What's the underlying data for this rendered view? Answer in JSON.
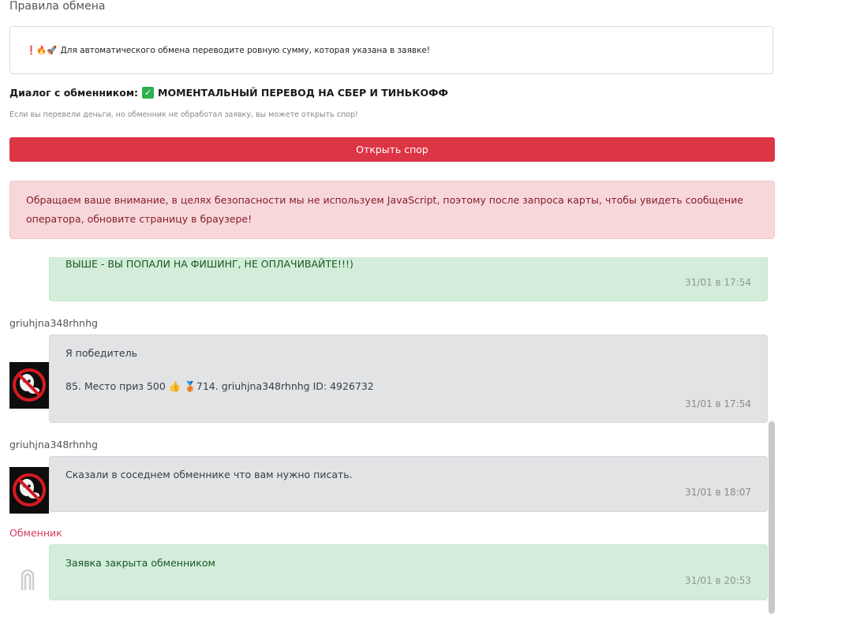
{
  "rules": {
    "title": "Правила обмена",
    "emojis": "❗🔥🚀",
    "text": "Для автоматического обмена переводите ровную сумму, которая указана в заявке!"
  },
  "dialog": {
    "label": "Диалог с обменником:",
    "exchanger_name": "МОМЕНТАЛЬНЫЙ ПЕРЕВОД НА СБЕР И ТИНЬКОФФ",
    "dispute_hint": "Если вы перевели деньги, но обменник не обработал заявку, вы можете открыть спор!",
    "dispute_button": "Открыть спор"
  },
  "alert": {
    "text": "Обращаем ваше внимание, в целях безопасности мы не используем JavaScript, поэтому после запроса карты, чтобы увидеть сообщение оператора, обновите страницу в браузере!"
  },
  "messages": [
    {
      "sender": "",
      "kind": "operator",
      "lines": [
        "ВЫШЕ - ВЫ ПОПАЛИ НА ФИШИНГ, НЕ ОПЛАЧИВАЙТЕ!!!)"
      ],
      "time": "31/01 в 17:54"
    },
    {
      "sender": "griuhjna348rhnhg",
      "kind": "user",
      "lines": [
        "Я победитель",
        "85. Место приз 500 👍 🥉714. griuhjna348rhnhg ID: 4926732"
      ],
      "time": "31/01 в 17:54"
    },
    {
      "sender": "griuhjna348rhnhg",
      "kind": "user",
      "lines": [
        "Сказали в соседнем обменнике что вам нужно писать."
      ],
      "time": "31/01 в 18:07"
    },
    {
      "sender": "Обменник",
      "kind": "operator",
      "lines": [
        "Заявка закрыта обменником"
      ],
      "time": "31/01 в 20:53"
    }
  ],
  "colors": {
    "danger": "#dc3545",
    "alert_bg": "#f8d7da",
    "operator_bubble": "#d4edda",
    "user_bubble": "#e2e3e5",
    "operator_name": "#d63a5c"
  }
}
